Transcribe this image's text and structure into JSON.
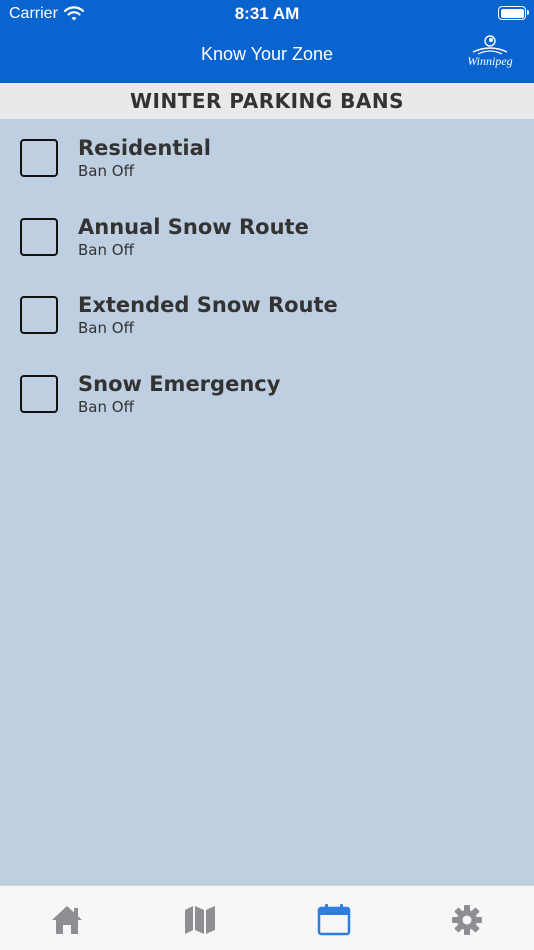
{
  "status_bar": {
    "carrier": "Carrier",
    "time": "8:31 AM"
  },
  "nav": {
    "title": "Know Your Zone",
    "logo_text": "Winnipeg"
  },
  "section": {
    "title": "WINTER PARKING BANS"
  },
  "bans": [
    {
      "name": "Residential",
      "status": "Ban Off",
      "checked": false
    },
    {
      "name": "Annual Snow Route",
      "status": "Ban Off",
      "checked": false
    },
    {
      "name": "Extended Snow Route",
      "status": "Ban Off",
      "checked": false
    },
    {
      "name": "Snow Emergency",
      "status": "Ban Off",
      "checked": false
    }
  ],
  "tab_bar": {
    "tabs": [
      {
        "icon": "home-icon",
        "active": false
      },
      {
        "icon": "map-icon",
        "active": false
      },
      {
        "icon": "calendar-icon",
        "active": true
      },
      {
        "icon": "gear-icon",
        "active": false
      }
    ]
  },
  "colors": {
    "header_blue": "#0a64d0",
    "background": "#bfcfe2",
    "tab_active": "#2f7de1",
    "tab_inactive": "#8e8e93"
  }
}
